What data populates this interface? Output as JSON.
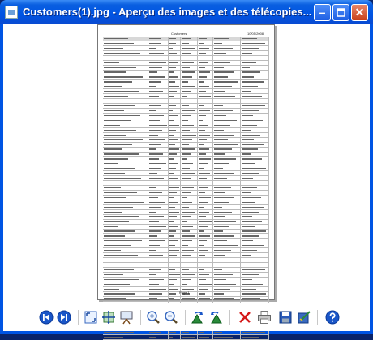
{
  "window": {
    "title": "Customers(1).jpg - Aperçu des images et des télécopies...",
    "minimize_glyph": "–",
    "close_glyph": "✕"
  },
  "document": {
    "title": "Customers",
    "date": "10/05/2008",
    "footer": "Page 1"
  },
  "toolbar": {
    "icons": [
      "previous-image-icon",
      "next-image-icon",
      "best-fit-icon",
      "actual-size-icon",
      "slideshow-icon",
      "zoom-in-icon",
      "zoom-out-icon",
      "rotate-clockwise-icon",
      "rotate-counterclockwise-icon",
      "delete-icon",
      "print-icon",
      "save-copy-icon",
      "open-editor-icon",
      "help-icon"
    ]
  },
  "colors": {
    "titlebar": "#0054e3",
    "client_bg": "#ffffff",
    "nav_button": "#1a56c8"
  }
}
